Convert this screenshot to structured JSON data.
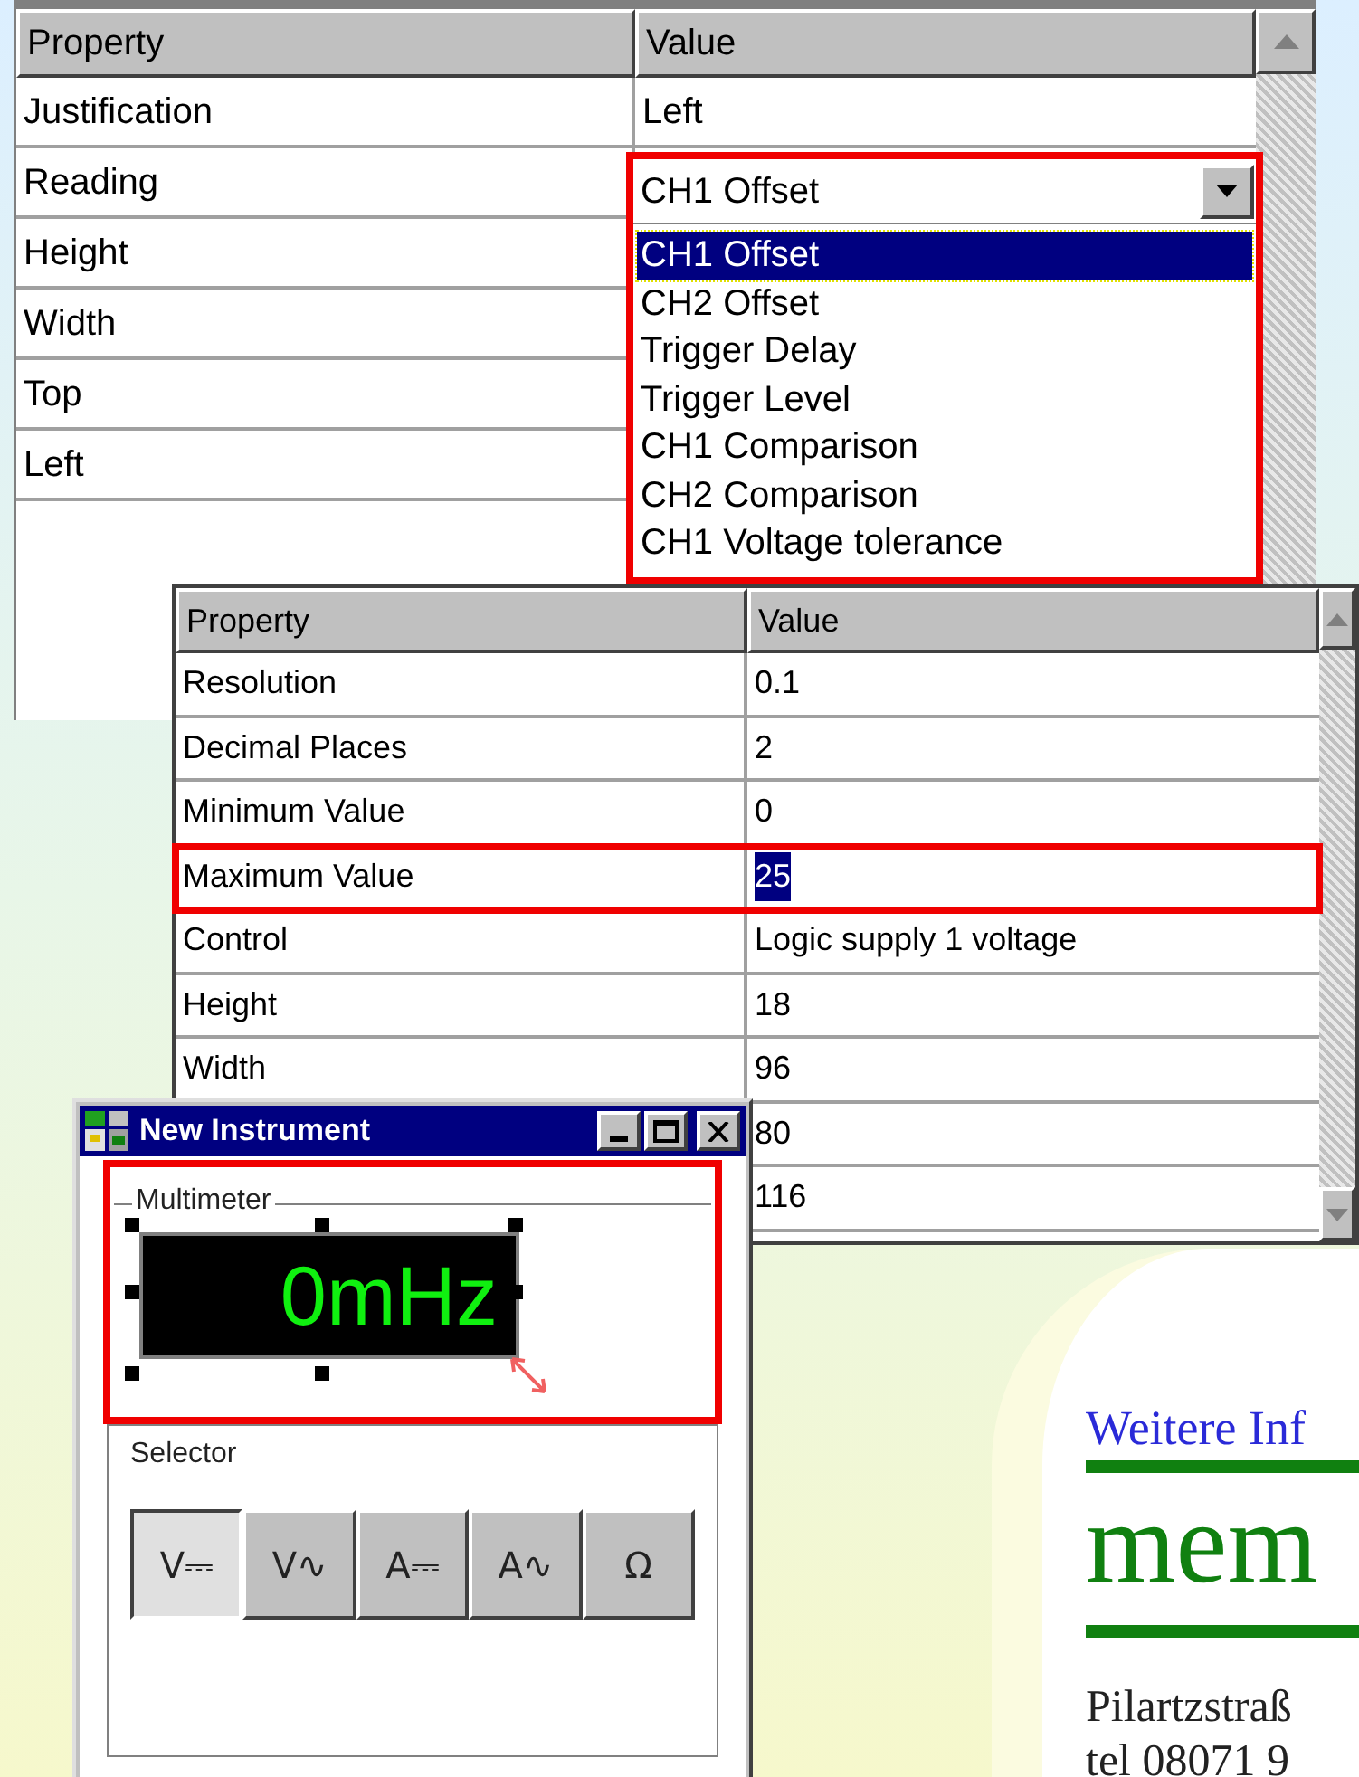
{
  "property_grid_1": {
    "columns": [
      "Property",
      "Value"
    ],
    "rows": [
      {
        "property": "Justification",
        "value": "Left"
      },
      {
        "property": "Reading",
        "value": "CH1 Offset",
        "kind": "dropdown"
      },
      {
        "property": "Height"
      },
      {
        "property": "Width"
      },
      {
        "property": "Top"
      },
      {
        "property": "Left"
      }
    ],
    "dropdown": {
      "highlighted": true,
      "items": [
        {
          "label": "CH1 Offset",
          "selected": true
        },
        {
          "label": "CH2 Offset",
          "selected": false
        },
        {
          "label": "Trigger Delay",
          "selected": false
        },
        {
          "label": "Trigger Level",
          "selected": false
        },
        {
          "label": "CH1 Comparison",
          "selected": false
        },
        {
          "label": "CH2 Comparison",
          "selected": false
        },
        {
          "label": "CH1 Voltage tolerance",
          "selected": false
        }
      ]
    }
  },
  "property_grid_2": {
    "columns": [
      "Property",
      "Value"
    ],
    "rows": [
      {
        "property": "Resolution",
        "value": "0.1",
        "highlighted": false,
        "value_selected": false
      },
      {
        "property": "Decimal Places",
        "value": "2",
        "highlighted": false,
        "value_selected": false
      },
      {
        "property": "Minimum Value",
        "value": "0",
        "highlighted": false,
        "value_selected": false
      },
      {
        "property": "Maximum Value",
        "value": "25",
        "highlighted": true,
        "value_selected": true
      },
      {
        "property": "Control",
        "value": "Logic supply 1 voltage",
        "highlighted": false,
        "value_selected": false
      },
      {
        "property": "Height",
        "value": "18",
        "highlighted": false,
        "value_selected": false
      },
      {
        "property": "Width",
        "value": "96",
        "highlighted": false,
        "value_selected": false
      },
      {
        "value": "80",
        "highlighted": false,
        "value_selected": false
      },
      {
        "value": "116",
        "highlighted": false,
        "value_selected": false
      }
    ]
  },
  "instrument_window": {
    "title": "New Instrument",
    "multimeter": {
      "label": "Multimeter",
      "reading": "0mHz",
      "highlighted": true
    },
    "selector": {
      "label": "Selector",
      "buttons": [
        {
          "label": "V⎓",
          "selected": true
        },
        {
          "label": "V∿",
          "selected": false
        },
        {
          "label": "A⎓",
          "selected": false
        },
        {
          "label": "A∿",
          "selected": false
        },
        {
          "label": "Ω",
          "selected": false
        }
      ]
    }
  },
  "brochure": {
    "heading": "Weitere Inf",
    "company": "mem",
    "address": "Pilartzstraß",
    "phone": "tel 08071 9"
  }
}
